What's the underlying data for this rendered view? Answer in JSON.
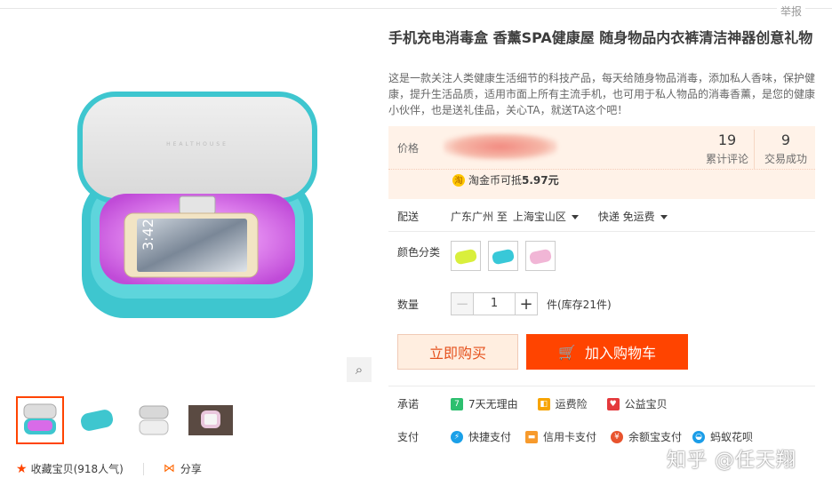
{
  "header": {
    "report_label": "举报"
  },
  "product": {
    "title": "手机充电消毒盒 香薰SPA健康屋 随身物品内衣裤清洁神器创意礼物",
    "description": "这是一款关注人类健康生活细节的科技产品，每天给随身物品消毒，添加私人香味，保护健康，提升生活品质，适用市面上所有主流手机，也可用于私人物品的消毒香薰，是您的健康小伙伴，也是送礼佳品，关心TA，就送TA这个吧！",
    "brand_text_on_lid": "HEALTHOUSE"
  },
  "price": {
    "label": "价格",
    "reviews_count": "19",
    "reviews_label": "累计评论",
    "deals_count": "9",
    "deals_label": "交易成功",
    "coin_icon": "淘",
    "coin_text": "淘金币可抵",
    "coin_value": "5.97元"
  },
  "delivery": {
    "label": "配送",
    "from": "广东广州 至",
    "to": "上海宝山区",
    "method": "快递 免运费"
  },
  "color": {
    "label": "颜色分类",
    "options": [
      {
        "name": "green-yellow",
        "color": "#d9ef3c"
      },
      {
        "name": "turquoise",
        "color": "#38c8d8"
      },
      {
        "name": "pink",
        "color": "#f1b6d6"
      }
    ]
  },
  "quantity": {
    "label": "数量",
    "minus": "−",
    "value": "1",
    "plus": "+",
    "stock_text": "件(库存21件)"
  },
  "actions": {
    "buy_now": "立即购买",
    "add_to_cart": "加入购物车"
  },
  "promise": {
    "label": "承诺",
    "items": [
      {
        "icon": "7",
        "text": "7天无理由",
        "color": "#2dbf6f"
      },
      {
        "icon": "◧",
        "text": "运费险",
        "color": "#f7a400"
      },
      {
        "icon": "♥",
        "text": "公益宝贝",
        "color": "#e4393c"
      }
    ]
  },
  "payment": {
    "label": "支付",
    "items": [
      {
        "icon": "⚡",
        "text": "快捷支付",
        "color": "#1aa0e8"
      },
      {
        "icon": "▬",
        "text": "信用卡支付",
        "color": "#f79a2c"
      },
      {
        "icon": "¥",
        "text": "余额宝支付",
        "color": "#e8532d"
      },
      {
        "icon": "◒",
        "text": "蚂蚁花呗",
        "color": "#1b9de8"
      }
    ]
  },
  "gallery": {
    "favorite_label": "收藏宝贝",
    "favorite_count": "(918人气)",
    "share_label": "分享"
  },
  "watermark": "知乎 @任天翔",
  "colors": {
    "accent": "#ff4400",
    "price_bg": "#fff2e8"
  }
}
